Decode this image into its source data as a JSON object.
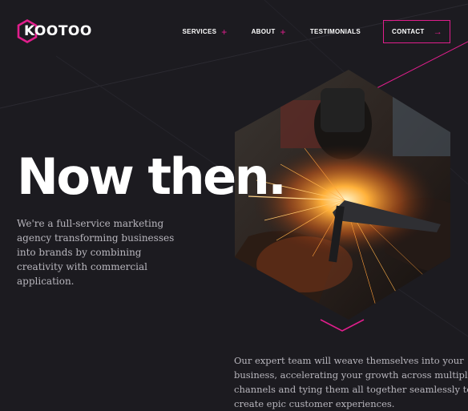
{
  "brand": {
    "logo_text": "KOOTOO"
  },
  "nav": {
    "items": [
      {
        "label": "SERVICES",
        "has_plus": true
      },
      {
        "label": "ABOUT",
        "has_plus": true
      },
      {
        "label": "TESTIMONIALS",
        "has_plus": false
      }
    ],
    "plus_symbol": "+",
    "contact_label": "CONTACT",
    "contact_arrow": "→"
  },
  "hero": {
    "headline": "Now then.",
    "intro": "We're a full-service marketing agency transforming businesses into brands by combining creativity with commercial application.",
    "image_icon": "welding-sparks-photo",
    "scroll_icon": "chevron-down-icon"
  },
  "section": {
    "body": "Our expert team will weave themselves into your business, accelerating your growth across multiple channels and tying them all together seamlessly to create epic customer experiences."
  },
  "colors": {
    "accent": "#e01e8c",
    "background": "#1c1b20",
    "text_muted": "#b8b6bd"
  }
}
